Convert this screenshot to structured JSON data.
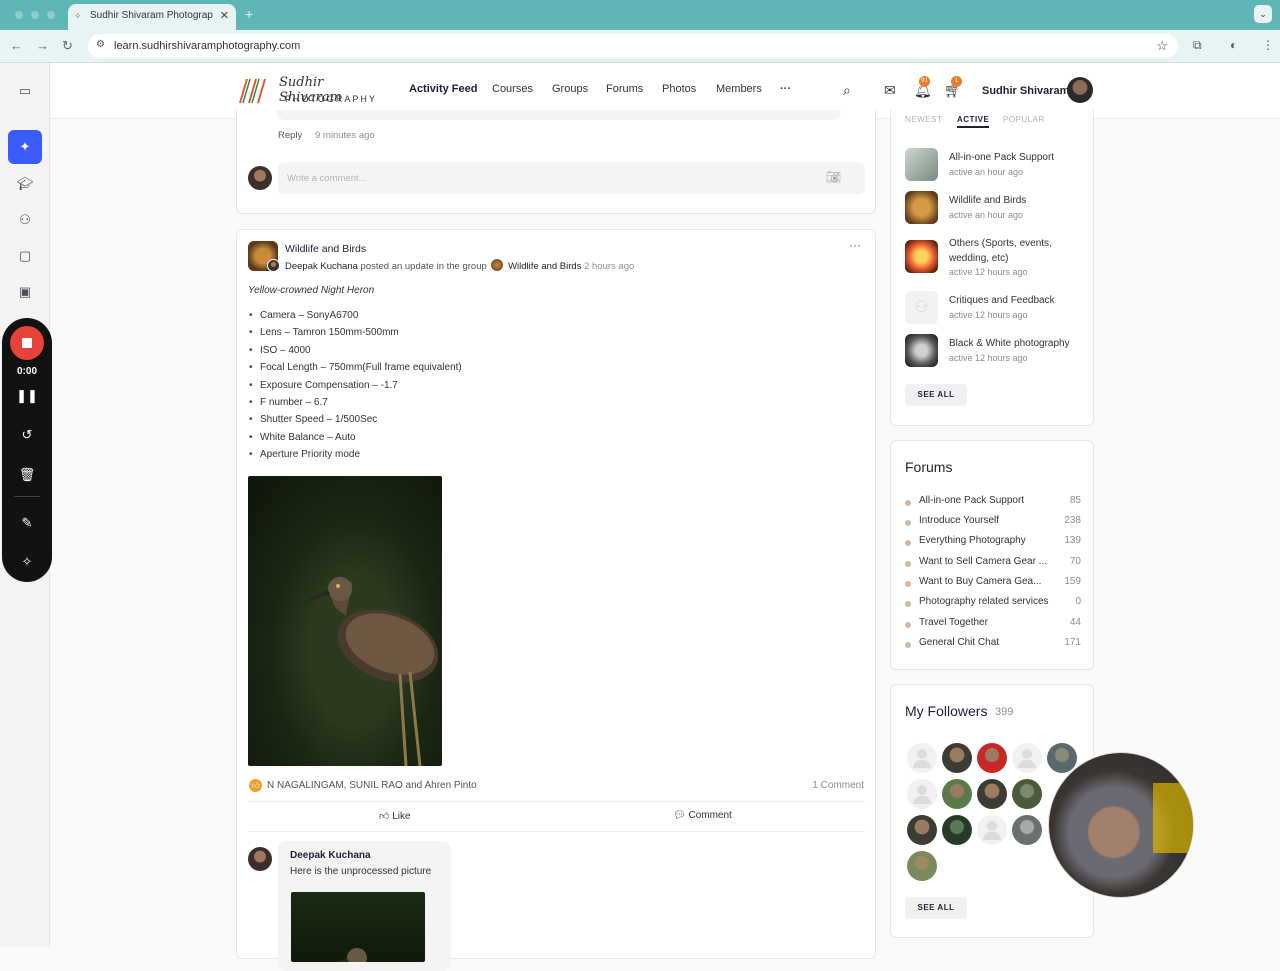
{
  "browser": {
    "tab_title": "Sudhir Shivaram Photograp",
    "url": "learn.sudhirshivaramphotography.com"
  },
  "recorder": {
    "time": "0:00"
  },
  "header": {
    "logo_line1": "Sudhir Shivaram",
    "logo_line2": "PHOTOGRAPHY",
    "nav": [
      "Activity Feed",
      "Courses",
      "Groups",
      "Forums",
      "Photos",
      "Members",
      "···"
    ],
    "notif_count": "91",
    "cart_count": "1",
    "user_name": "Sudhir Shivaram"
  },
  "prev_comment": {
    "reply_label": "Reply",
    "time": "9 minutes ago",
    "write_placeholder": "Write a comment..."
  },
  "post": {
    "group_name": "Wildlife and Birds",
    "author": "Deepak Kuchana",
    "action_text": "posted an update in the group",
    "group_link": "Wildlife and Birds",
    "time": "2 hours ago",
    "caption": "Yellow-crowned Night Heron",
    "specs": [
      "Camera – SonyA6700",
      "Lens – Tamron 150mm-500mm",
      "ISO – 4000",
      "Focal Length – 750mm(Full frame equivalent)",
      "Exposure Compensation – -1.7",
      "F number – 6.7",
      "Shutter Speed – 1/500Sec",
      "White Balance – Auto",
      "Aperture Priority mode"
    ],
    "reactions": "N NAGALINGAM, SUNIL RAO and Ahren Pinto",
    "comment_count": "1 Comment",
    "like_label": "Like",
    "comment_label": "Comment",
    "comment_author": "Deepak Kuchana",
    "comment_text": "Here is the unprocessed picture"
  },
  "groups_widget": {
    "tabs": [
      "NEWEST",
      "ACTIVE",
      "POPULAR"
    ],
    "items": [
      {
        "name": "All-in-one Pack Support",
        "activity": "active an hour ago"
      },
      {
        "name": "Wildlife and Birds",
        "activity": "active an hour ago"
      },
      {
        "name": "Others (Sports, events, wedding, etc)",
        "activity": "active 12 hours ago"
      },
      {
        "name": "Critiques and Feedback",
        "activity": "active 12 hours ago"
      },
      {
        "name": "Black & White photography",
        "activity": "active 12 hours ago"
      }
    ],
    "see_all": "SEE ALL"
  },
  "forums_widget": {
    "title": "Forums",
    "items": [
      {
        "name": "All-in-one Pack Support",
        "count": "85"
      },
      {
        "name": "Introduce Yourself",
        "count": "238"
      },
      {
        "name": "Everything Photography",
        "count": "139"
      },
      {
        "name": "Want to Sell Camera Gear ...",
        "count": "70"
      },
      {
        "name": "Want to Buy Camera Gea...",
        "count": "159"
      },
      {
        "name": "Photography related services",
        "count": "0"
      },
      {
        "name": "Travel Together",
        "count": "44"
      },
      {
        "name": "General Chit Chat",
        "count": "171"
      }
    ]
  },
  "followers_widget": {
    "title": "My Followers",
    "count": "399",
    "see_all": "SEE ALL"
  },
  "colors": {
    "accent": "#3b5bfd",
    "browser_bar": "#5fb6b4",
    "badge": "#ee7b2b",
    "record": "#e8433a"
  }
}
